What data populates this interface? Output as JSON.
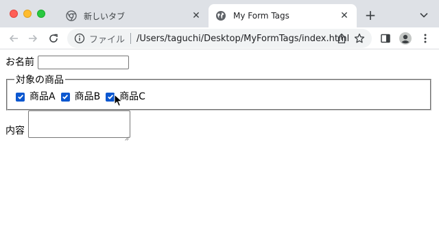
{
  "window": {
    "tabs": [
      {
        "title": "新しいタブ",
        "icon": "chrome-icon",
        "active": false
      },
      {
        "title": "My Form Tags",
        "icon": "globe-icon",
        "active": true
      }
    ],
    "new_tab_label": "+"
  },
  "toolbar": {
    "scheme_label": "ファイル",
    "url": "/Users/taguchi/Desktop/MyFormTags/index.html"
  },
  "form": {
    "name_label": "お名前",
    "name_value": "",
    "fieldset_legend": "対象の商品",
    "products": [
      {
        "label": "商品A",
        "checked": true
      },
      {
        "label": "商品B",
        "checked": true
      },
      {
        "label": "商品C",
        "checked": true
      }
    ],
    "content_label": "内容",
    "content_value": ""
  },
  "colors": {
    "tabstrip": "#dee1e6",
    "checkbox_accent": "#0b57d0",
    "close": "#ff5f57",
    "minimize": "#febc2e",
    "maximize": "#28c840"
  }
}
